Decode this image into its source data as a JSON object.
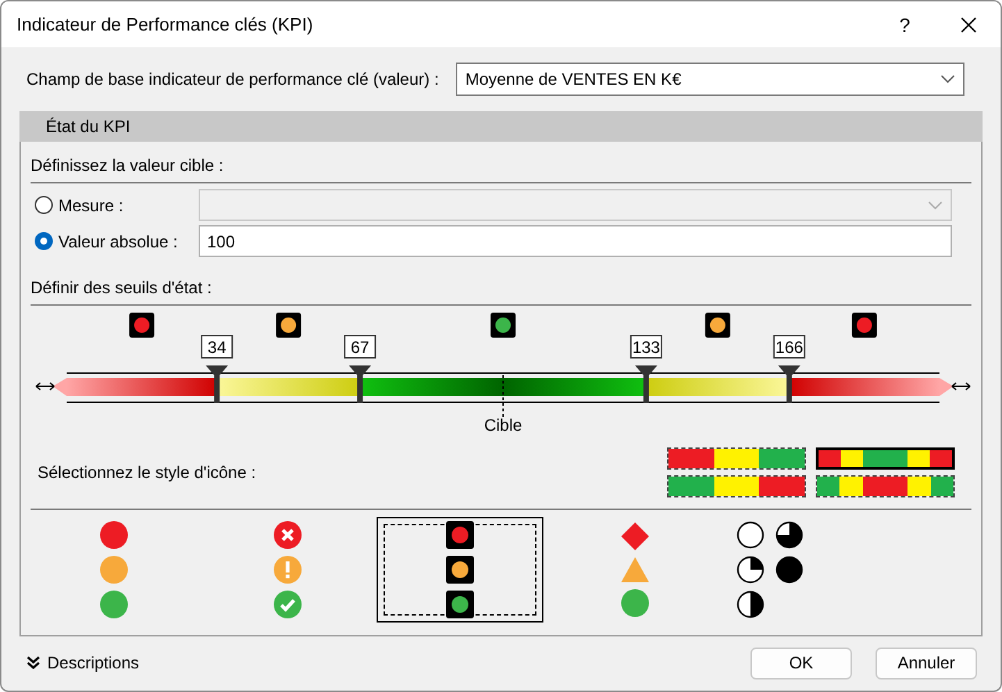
{
  "window": {
    "title": "Indicateur de Performance clés (KPI)",
    "help": "?"
  },
  "base_field": {
    "label": "Champ de base indicateur de performance clé (valeur) :",
    "value": "Moyenne de VENTES EN K€"
  },
  "tab": {
    "label": "État du KPI"
  },
  "target": {
    "heading": "Définissez la valeur cible :",
    "options": [
      {
        "label": "Mesure :",
        "selected": false,
        "kind": "dropdown",
        "disabled": true
      },
      {
        "label": "Valeur absolue :",
        "selected": true,
        "kind": "text",
        "value": "100"
      }
    ]
  },
  "thresholds": {
    "heading": "Définir des seuils d'état :",
    "target_label": "Cible",
    "lights": [
      {
        "color": "#ed1c24"
      },
      {
        "color": "#f7a93b"
      },
      {
        "color": "#3cb54a"
      },
      {
        "color": "#f7a93b"
      },
      {
        "color": "#ed1c24"
      }
    ],
    "values": [
      "34",
      "67",
      "133",
      "166"
    ]
  },
  "icon_style": {
    "label": "Sélectionnez le style d'icône :",
    "swatches": [
      {
        "selected": false,
        "segments": [
          {
            "color": "#ed1c24"
          },
          {
            "color": "#fff200"
          },
          {
            "color": "#22b14c"
          }
        ]
      },
      {
        "selected": true,
        "segments": [
          {
            "color": "#ed1c24"
          },
          {
            "color": "#fff200"
          },
          {
            "color": "#22b14c"
          },
          {
            "color": "#22b14c"
          },
          {
            "color": "#fff200"
          },
          {
            "color": "#ed1c24"
          }
        ]
      },
      {
        "selected": false,
        "segments": [
          {
            "color": "#22b14c"
          },
          {
            "color": "#fff200"
          },
          {
            "color": "#ed1c24"
          }
        ]
      },
      {
        "selected": false,
        "segments": [
          {
            "color": "#22b14c"
          },
          {
            "color": "#fff200"
          },
          {
            "color": "#ed1c24"
          },
          {
            "color": "#ed1c24"
          },
          {
            "color": "#fff200"
          },
          {
            "color": "#22b14c"
          }
        ]
      }
    ]
  },
  "icon_sets": [
    {
      "selected": false,
      "icons": [
        {
          "kind": "dot",
          "color": "#ed1c24"
        },
        {
          "kind": "dot",
          "color": "#f7a93b"
        },
        {
          "kind": "dot",
          "color": "#3cb54a"
        }
      ]
    },
    {
      "selected": false,
      "icons": [
        {
          "kind": "cross",
          "color": "#ed1c24"
        },
        {
          "kind": "exclaim",
          "color": "#f7a93b"
        },
        {
          "kind": "check",
          "color": "#3cb54a"
        }
      ]
    },
    {
      "selected": true,
      "icons": [
        {
          "kind": "light",
          "color": "#ed1c24"
        },
        {
          "kind": "light",
          "color": "#f7a93b"
        },
        {
          "kind": "light",
          "color": "#3cb54a"
        }
      ]
    },
    {
      "selected": false,
      "icons": [
        {
          "kind": "diamond",
          "color": "#ed1c24"
        },
        {
          "kind": "triangle",
          "color": "#f7a93b"
        },
        {
          "kind": "dot",
          "color": "#3cb54a"
        }
      ]
    },
    {
      "selected": false,
      "icons": [
        {
          "kind": "empty"
        },
        {
          "kind": "three-quarter"
        },
        {
          "kind": "quarter"
        },
        {
          "kind": "full"
        },
        {
          "kind": "half"
        }
      ]
    }
  ],
  "footer": {
    "descriptions": "Descriptions",
    "buttons": [
      "OK",
      "Annuler"
    ]
  }
}
